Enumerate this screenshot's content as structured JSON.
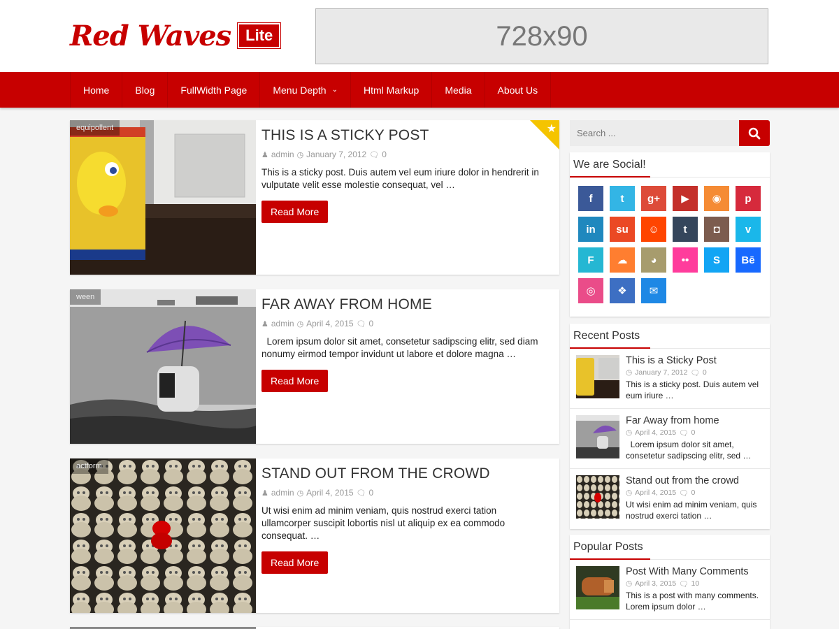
{
  "header": {
    "logo_text": "Red Waves",
    "logo_badge": "Lite",
    "ad_label": "728x90"
  },
  "nav": {
    "items": [
      "Home",
      "Blog",
      "FullWidth Page",
      "Menu Depth",
      "Html Markup",
      "Media",
      "About Us"
    ]
  },
  "posts": [
    {
      "title": "THIS IS A STICKY POST",
      "author": "admin",
      "date": "January 7, 2012",
      "comments": "0",
      "excerpt": "This is a sticky post. Duis autem vel eum iriure dolor in hendrerit in vulputate velit esse molestie consequat, vel …",
      "read_more": "Read More",
      "thumb_tag": "equipollent"
    },
    {
      "title": "FAR AWAY FROM HOME",
      "author": "admin",
      "date": "April 4, 2015",
      "comments": "0",
      "excerpt": "Lorem ipsum dolor sit amet, consetetur sadipscing elitr, sed diam nonumy eirmod tempor invidunt ut labore et dolore magna …",
      "read_more": "Read More",
      "thumb_tag": "ween"
    },
    {
      "title": "STAND OUT FROM THE CROWD",
      "author": "admin",
      "date": "April 4, 2015",
      "comments": "0",
      "excerpt": "Ut wisi enim ad minim veniam, quis nostrud exerci tation ullamcorper suscipit lobortis nisl ut aliquip ex ea commodo consequat. …",
      "read_more": "Read More",
      "thumb_tag": "actform"
    }
  ],
  "sidebar": {
    "search_placeholder": "Search ...",
    "social_title": "We are Social!",
    "social_icons": [
      {
        "name": "facebook",
        "glyph": "f",
        "color": "#3b5998"
      },
      {
        "name": "twitter",
        "glyph": "t",
        "color": "#33b5e5"
      },
      {
        "name": "google-plus",
        "glyph": "g+",
        "color": "#dd4b39"
      },
      {
        "name": "youtube",
        "glyph": "▶",
        "color": "#c4302b"
      },
      {
        "name": "rss",
        "glyph": "◉",
        "color": "#f58b34"
      },
      {
        "name": "pinterest",
        "glyph": "p",
        "color": "#d62a3c"
      },
      {
        "name": "linkedin",
        "glyph": "in",
        "color": "#1f88be"
      },
      {
        "name": "stumbleupon",
        "glyph": "su",
        "color": "#eb4924"
      },
      {
        "name": "reddit",
        "glyph": "☺",
        "color": "#ff4500"
      },
      {
        "name": "tumblr",
        "glyph": "t",
        "color": "#35465c"
      },
      {
        "name": "instagram",
        "glyph": "◘",
        "color": "#7c5c4f"
      },
      {
        "name": "vimeo",
        "glyph": "v",
        "color": "#1ab7ea"
      },
      {
        "name": "foursquare",
        "glyph": "F",
        "color": "#25b7d3"
      },
      {
        "name": "soundcloud",
        "glyph": "☁",
        "color": "#ff7e30"
      },
      {
        "name": "github",
        "glyph": "◕",
        "color": "#a79c6d"
      },
      {
        "name": "flickr",
        "glyph": "••",
        "color": "#ff3c9c"
      },
      {
        "name": "skype",
        "glyph": "S",
        "color": "#12a5f4"
      },
      {
        "name": "behance",
        "glyph": "Bē",
        "color": "#1769ff"
      },
      {
        "name": "dribbble",
        "glyph": "◎",
        "color": "#ea4c89"
      },
      {
        "name": "dropbox",
        "glyph": "❖",
        "color": "#3d6fc3"
      },
      {
        "name": "email",
        "glyph": "✉",
        "color": "#1e88e5"
      }
    ],
    "recent_title": "Recent Posts",
    "recent_posts": [
      {
        "title": "This is a Sticky Post",
        "date": "January 7, 2012",
        "comments": "0",
        "excerpt": "This is a sticky post. Duis autem vel eum iriure …"
      },
      {
        "title": "Far Away from home",
        "date": "April 4, 2015",
        "comments": "0",
        "excerpt": "Lorem ipsum dolor sit amet, consetetur sadipscing elitr, sed …"
      },
      {
        "title": "Stand out from the crowd",
        "date": "April 4, 2015",
        "comments": "0",
        "excerpt": "Ut wisi enim ad minim veniam, quis nostrud exerci tation …"
      }
    ],
    "popular_title": "Popular Posts",
    "popular_posts": [
      {
        "title": "Post With Many Comments",
        "date": "April 3, 2015",
        "comments": "10",
        "excerpt": "This is a post with many comments. Lorem ipsum dolor …"
      }
    ]
  }
}
